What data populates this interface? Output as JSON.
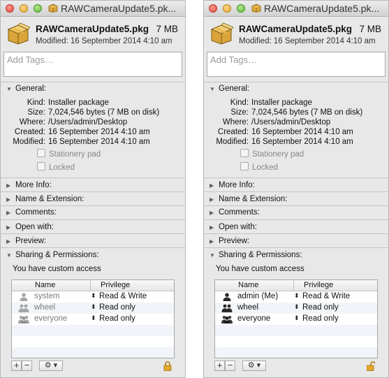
{
  "windows": [
    {
      "title": "RAWCameraUpdate5.pk...",
      "file_name": "RAWCameraUpdate5.pkg",
      "file_size": "7 MB",
      "modified": "Modified: 16 September 2014 4:10 am",
      "tags_placeholder": "Add Tags…",
      "sections": {
        "general": "General:",
        "more_info": "More Info:",
        "name_ext": "Name & Extension:",
        "comments": "Comments:",
        "open_with": "Open with:",
        "preview": "Preview:",
        "sharing": "Sharing & Permissions:"
      },
      "info": [
        {
          "k": "Kind:",
          "v": "Installer package"
        },
        {
          "k": "Size:",
          "v": "7,024,546 bytes (7 MB on disk)"
        },
        {
          "k": "Where:",
          "v": "/Users/admin/Desktop"
        },
        {
          "k": "Created:",
          "v": "16 September 2014 4:10 am"
        },
        {
          "k": "Modified:",
          "v": "16 September 2014 4:10 am"
        }
      ],
      "stationery": "Stationery pad",
      "locked": "Locked",
      "access": "You have custom access",
      "col_name": "Name",
      "col_privilege": "Privilege",
      "perms": [
        {
          "name": "system",
          "privilege": "Read & Write",
          "icon": "single-user-icon"
        },
        {
          "name": "wheel",
          "privilege": "Read only",
          "icon": "group-icon"
        },
        {
          "name": "everyone",
          "privilege": "Read only",
          "icon": "everyone-icon"
        }
      ],
      "lock_state": "locked"
    },
    {
      "title": "RAWCameraUpdate5.pk...",
      "file_name": "RAWCameraUpdate5.pkg",
      "file_size": "7 MB",
      "modified": "Modified: 16 September 2014 4:10 am",
      "tags_placeholder": "Add Tags…",
      "sections": {
        "general": "General:",
        "more_info": "More Info:",
        "name_ext": "Name & Extension:",
        "comments": "Comments:",
        "open_with": "Open with:",
        "preview": "Preview:",
        "sharing": "Sharing & Permissions:"
      },
      "info": [
        {
          "k": "Kind:",
          "v": "Installer package"
        },
        {
          "k": "Size:",
          "v": "7,024,546 bytes (7 MB on disk)"
        },
        {
          "k": "Where:",
          "v": "/Users/admin/Desktop"
        },
        {
          "k": "Created:",
          "v": "16 September 2014 4:10 am"
        },
        {
          "k": "Modified:",
          "v": "16 September 2014 4:10 am"
        }
      ],
      "stationery": "Stationery pad",
      "locked": "Locked",
      "access": "You have custom access",
      "col_name": "Name",
      "col_privilege": "Privilege",
      "perms": [
        {
          "name": "admin (Me)",
          "privilege": "Read & Write",
          "icon": "single-user-icon"
        },
        {
          "name": "wheel",
          "privilege": "Read only",
          "icon": "group-icon"
        },
        {
          "name": "everyone",
          "privilege": "Read only",
          "icon": "everyone-icon"
        }
      ],
      "lock_state": "unlocked"
    }
  ],
  "icons": {
    "arrow_down": "▼",
    "arrow_right": "▶",
    "updown": "⬍",
    "plus": "+",
    "minus": "−",
    "gear": "⚙ ▾"
  },
  "colors": {
    "window_bg": "#e8e8e8",
    "alt_row": "#f1f4f9",
    "dim_text": "#7a7a7a"
  }
}
